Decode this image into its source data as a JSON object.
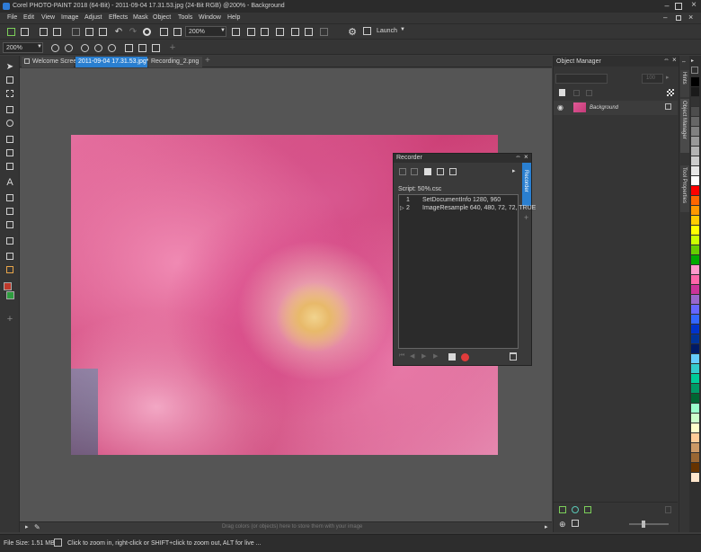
{
  "title_bar": {
    "title": "Corel PHOTO-PAINT 2018 (64-Bit) - 2011-09-04 17.31.53.jpg (24-Bit RGB) @200% - Background"
  },
  "menu": [
    "File",
    "Edit",
    "View",
    "Image",
    "Adjust",
    "Effects",
    "Mask",
    "Object",
    "Tools",
    "Window",
    "Help"
  ],
  "toolbar": {
    "zoom_value": "200%",
    "launch_label": "Launch"
  },
  "property_bar": {
    "zoom_value": "200%"
  },
  "tabs": [
    {
      "label": "Welcome Screen"
    },
    {
      "label": "2011-09-04 17.31.53.jpg*"
    },
    {
      "label": "Recording_2.png"
    }
  ],
  "recorder": {
    "title": "Recorder",
    "side_tab": "Recorder",
    "script_label": "Script: 50%.csc",
    "rows": [
      {
        "num": "1",
        "command": "SetDocumentInfo 1280, 960"
      },
      {
        "num": "2",
        "command": "ImageResample 640, 480, 72, 72, TRUE"
      }
    ]
  },
  "object_manager": {
    "title": "Object Manager",
    "opacity": "100",
    "layer_name": "Background"
  },
  "right_tabs": [
    "Hints",
    "Object Manager",
    "Tool Properties"
  ],
  "canvas": {
    "hint": "Drag colors (or objects) here to store them with your image"
  },
  "status": {
    "file_size": "File Size: 1.51 MB",
    "message": "Click to zoom in, right-click or SHIFT+click to zoom out, ALT for live ..."
  },
  "palette": [
    "#000000",
    "#1a1a1a",
    "#333333",
    "#4d4d4d",
    "#666666",
    "#808080",
    "#999999",
    "#b3b3b3",
    "#cccccc",
    "#e6e6e6",
    "#ffffff",
    "#ff0000",
    "#ff6600",
    "#ff9900",
    "#ffcc00",
    "#ffff00",
    "#ccff00",
    "#66cc00",
    "#00aa00",
    "#ff99cc",
    "#ff66aa",
    "#cc3399",
    "#9966cc",
    "#6666ff",
    "#3366ff",
    "#0033cc",
    "#003399",
    "#001a66",
    "#66ccff",
    "#33cccc",
    "#00cc99",
    "#009966",
    "#006633",
    "#99ffcc",
    "#ccffcc",
    "#ffffcc",
    "#ffcc99",
    "#cc9966",
    "#996633",
    "#663300",
    "#ffe6cc"
  ]
}
